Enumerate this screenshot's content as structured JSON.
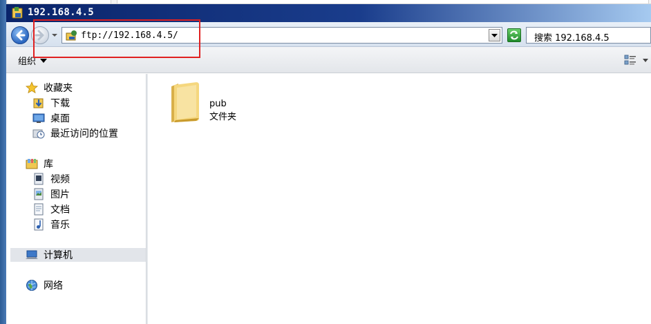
{
  "window": {
    "title": "192.168.4.5"
  },
  "address_bar": {
    "value": "ftp://192.168.4.5/"
  },
  "search": {
    "placeholder": "搜索 192.168.4.5"
  },
  "toolbar": {
    "organize_label": "组织"
  },
  "sidebar": {
    "favorites": {
      "label": "收藏夹",
      "icon": "star-icon",
      "items": [
        {
          "label": "下载",
          "icon": "downloads-icon"
        },
        {
          "label": "桌面",
          "icon": "desktop-icon"
        },
        {
          "label": "最近访问的位置",
          "icon": "recent-places-icon"
        }
      ]
    },
    "libraries": {
      "label": "库",
      "icon": "library-icon",
      "items": [
        {
          "label": "视频",
          "icon": "video-icon"
        },
        {
          "label": "图片",
          "icon": "pictures-icon"
        },
        {
          "label": "文档",
          "icon": "documents-icon"
        },
        {
          "label": "音乐",
          "icon": "music-icon"
        }
      ]
    },
    "computer": {
      "label": "计算机",
      "icon": "computer-icon"
    },
    "network": {
      "label": "网络",
      "icon": "network-icon"
    }
  },
  "content": {
    "items": [
      {
        "name": "pub",
        "type": "文件夹",
        "icon": "folder-icon"
      }
    ]
  },
  "colors": {
    "title_bar_start": "#0a246a",
    "title_bar_end": "#a6caf0",
    "highlight_box": "#e02020",
    "selected_row": "#e2e5ea",
    "folder": "#f3cf6d"
  }
}
